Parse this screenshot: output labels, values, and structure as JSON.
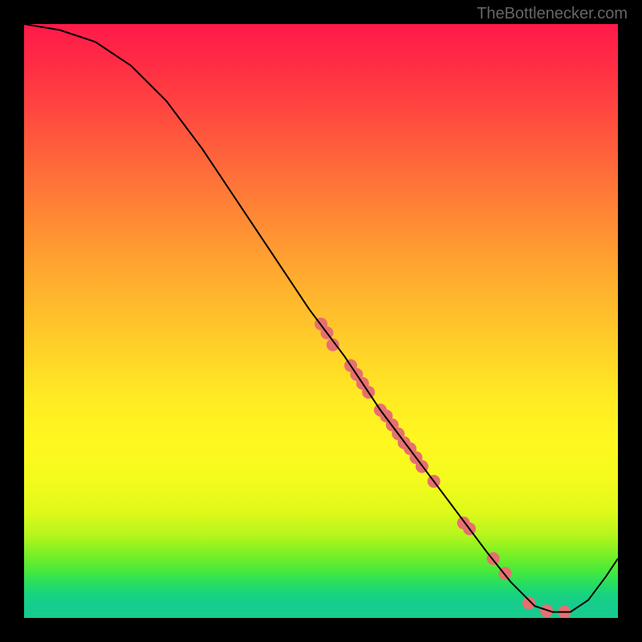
{
  "watermark": "TheBottleneсker.com",
  "chart_data": {
    "type": "line",
    "title": "",
    "xlabel": "",
    "ylabel": "",
    "x_range": [
      0,
      100
    ],
    "y_range": [
      0,
      100
    ],
    "curve": [
      {
        "x": 0,
        "y": 100
      },
      {
        "x": 6,
        "y": 99
      },
      {
        "x": 12,
        "y": 97
      },
      {
        "x": 18,
        "y": 93
      },
      {
        "x": 24,
        "y": 87
      },
      {
        "x": 30,
        "y": 79
      },
      {
        "x": 36,
        "y": 70
      },
      {
        "x": 42,
        "y": 61
      },
      {
        "x": 48,
        "y": 52
      },
      {
        "x": 54,
        "y": 44
      },
      {
        "x": 60,
        "y": 35
      },
      {
        "x": 66,
        "y": 27
      },
      {
        "x": 72,
        "y": 19
      },
      {
        "x": 78,
        "y": 11
      },
      {
        "x": 82,
        "y": 6
      },
      {
        "x": 86,
        "y": 2
      },
      {
        "x": 89,
        "y": 1
      },
      {
        "x": 92,
        "y": 1
      },
      {
        "x": 95,
        "y": 3
      },
      {
        "x": 98,
        "y": 7
      },
      {
        "x": 100,
        "y": 10
      }
    ],
    "points": [
      {
        "x": 50,
        "y": 49.5
      },
      {
        "x": 51,
        "y": 48
      },
      {
        "x": 52,
        "y": 46
      },
      {
        "x": 55,
        "y": 42.5
      },
      {
        "x": 56,
        "y": 41
      },
      {
        "x": 57,
        "y": 39.5
      },
      {
        "x": 58,
        "y": 38
      },
      {
        "x": 60,
        "y": 35
      },
      {
        "x": 61,
        "y": 34
      },
      {
        "x": 62,
        "y": 32.5
      },
      {
        "x": 63,
        "y": 31
      },
      {
        "x": 64,
        "y": 29.5
      },
      {
        "x": 65,
        "y": 28.5
      },
      {
        "x": 66,
        "y": 27
      },
      {
        "x": 67,
        "y": 25.5
      },
      {
        "x": 69,
        "y": 23
      },
      {
        "x": 74,
        "y": 16
      },
      {
        "x": 75,
        "y": 15
      },
      {
        "x": 79,
        "y": 10
      },
      {
        "x": 81,
        "y": 7.5
      },
      {
        "x": 85,
        "y": 2.5
      },
      {
        "x": 88,
        "y": 1.2
      },
      {
        "x": 91,
        "y": 1
      }
    ],
    "point_style": {
      "color": "#e76f6f",
      "radius": 8
    }
  }
}
